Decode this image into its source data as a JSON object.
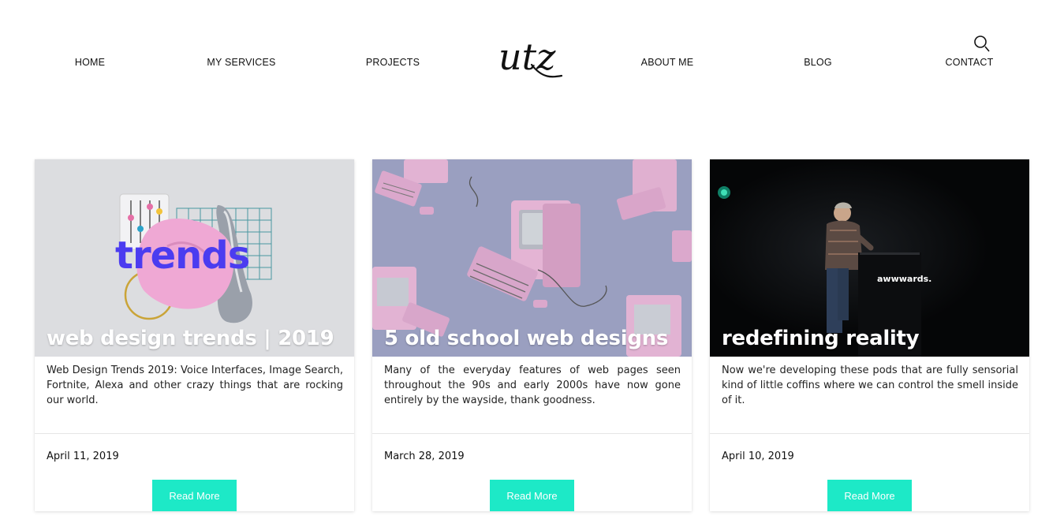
{
  "nav": {
    "items": [
      "HOME",
      "MY SERVICES",
      "PROJECTS",
      "ABOUT ME",
      "BLOG",
      "CONTACT"
    ],
    "logo_text": "utz"
  },
  "posts": [
    {
      "title": "web design trends | 2019",
      "image_word": "trends",
      "excerpt": "Web Design Trends 2019: Voice Interfaces, Image Search, Fortnite, Alexa and other crazy things that are rocking our world.",
      "date": "April 11, 2019",
      "button": "Read More"
    },
    {
      "title": "5 old school web designs",
      "excerpt": "Many of the everyday features of web pages seen throughout the 90s and early 2000s have now gone entirely by the wayside, thank goodness.",
      "date": "March 28, 2019",
      "button": "Read More"
    },
    {
      "title": "redefining reality",
      "image_word": "awwwards.",
      "excerpt": "Now we're developing these pods that are fully sensorial kind of little coffins where we can control the smell inside of it.",
      "date": "April 10, 2019",
      "button": "Read More"
    }
  ],
  "colors": {
    "accent": "#1de9c7",
    "trends_purple": "#4b3cf0",
    "pink": "#e8a8d6",
    "retro_bg": "#9a9fc0"
  }
}
